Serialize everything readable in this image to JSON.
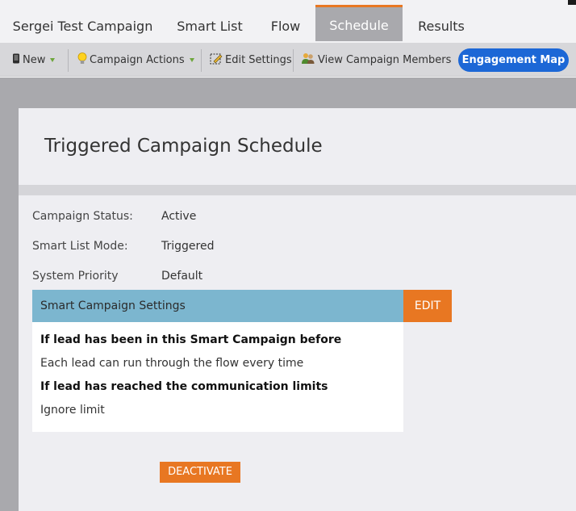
{
  "tabs": [
    {
      "label": "Sergei Test Campaign",
      "active": false
    },
    {
      "label": "Smart List",
      "active": false
    },
    {
      "label": "Flow",
      "active": false
    },
    {
      "label": "Schedule",
      "active": true
    },
    {
      "label": "Results",
      "active": false
    }
  ],
  "toolbar": {
    "new_label": "New",
    "new_icon": "mobile-icon",
    "campaign_actions_label": "Campaign Actions",
    "campaign_actions_icon": "lightbulb-icon",
    "edit_settings_label": "Edit Settings",
    "edit_settings_icon": "edit-settings-icon",
    "view_members_label": "View Campaign Members",
    "view_members_icon": "people-icon",
    "engagement_map_label": "Engagement Map"
  },
  "header": {
    "title": "Triggered Campaign Schedule"
  },
  "details": {
    "campaign_status_label": "Campaign Status:",
    "campaign_status_value": "Active",
    "smart_list_mode_label": "Smart List Mode:",
    "smart_list_mode_value": "Triggered",
    "system_priority_label": "System Priority",
    "system_priority_value": "Default"
  },
  "settings": {
    "heading": "Smart Campaign Settings",
    "edit_label": "EDIT",
    "lines": [
      {
        "text": "If lead has been in this Smart Campaign before",
        "bold": true
      },
      {
        "text": "Each lead can run through the flow every time",
        "bold": false
      },
      {
        "text": "If lead has reached the communication limits",
        "bold": true
      },
      {
        "text": "Ignore limit",
        "bold": false
      }
    ]
  },
  "actions": {
    "deactivate_label": "DEACTIVATE"
  },
  "colors": {
    "accent_orange": "#e87722",
    "settings_header_blue": "#7cb6cf",
    "engagement_blue": "#1c67d6",
    "tab_active_gray": "#a9a9ad"
  }
}
